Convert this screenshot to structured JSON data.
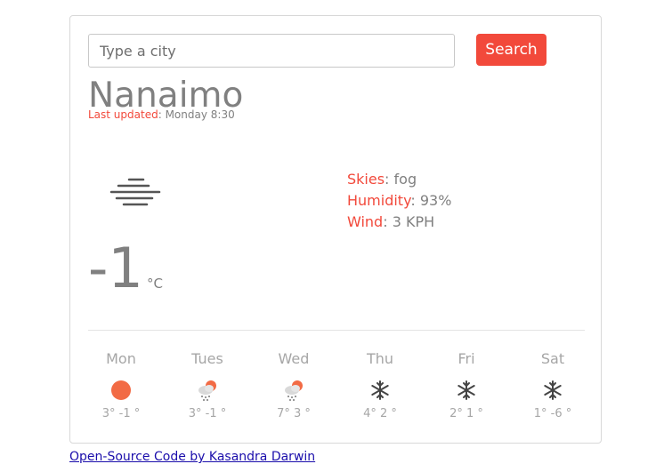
{
  "search": {
    "placeholder": "Type a city",
    "button_label": "Search"
  },
  "current": {
    "city": "Nanaimo",
    "updated_label": "Last updated",
    "updated_value": "Monday 8:30",
    "icon": "fog-icon",
    "skies_label": "Skies",
    "skies_value": "fog",
    "humidity_label": "Humidity",
    "humidity_value": "93%",
    "wind_label": "Wind",
    "wind_value": "3 KPH",
    "temperature": "-1",
    "unit": "°C"
  },
  "forecast": [
    {
      "day": "Mon",
      "icon": "sun-icon",
      "high": "3°",
      "low": "-1 °"
    },
    {
      "day": "Tues",
      "icon": "snow-cloud-sun-icon",
      "high": "3°",
      "low": "-1 °"
    },
    {
      "day": "Wed",
      "icon": "snow-cloud-sun-icon",
      "high": "7°",
      "low": "3 °"
    },
    {
      "day": "Thu",
      "icon": "snowflake-icon",
      "high": "4°",
      "low": "2 °"
    },
    {
      "day": "Fri",
      "icon": "snowflake-icon",
      "high": "2°",
      "low": "1 °"
    },
    {
      "day": "Sat",
      "icon": "snowflake-icon",
      "high": "1°",
      "low": "-6 °"
    }
  ],
  "footer": {
    "link_text": "Open-Source Code by Kasandra Darwin"
  },
  "colors": {
    "accent": "#f2493b",
    "text": "#808080",
    "muted": "#a6a6a6",
    "sun": "#f26b45"
  }
}
